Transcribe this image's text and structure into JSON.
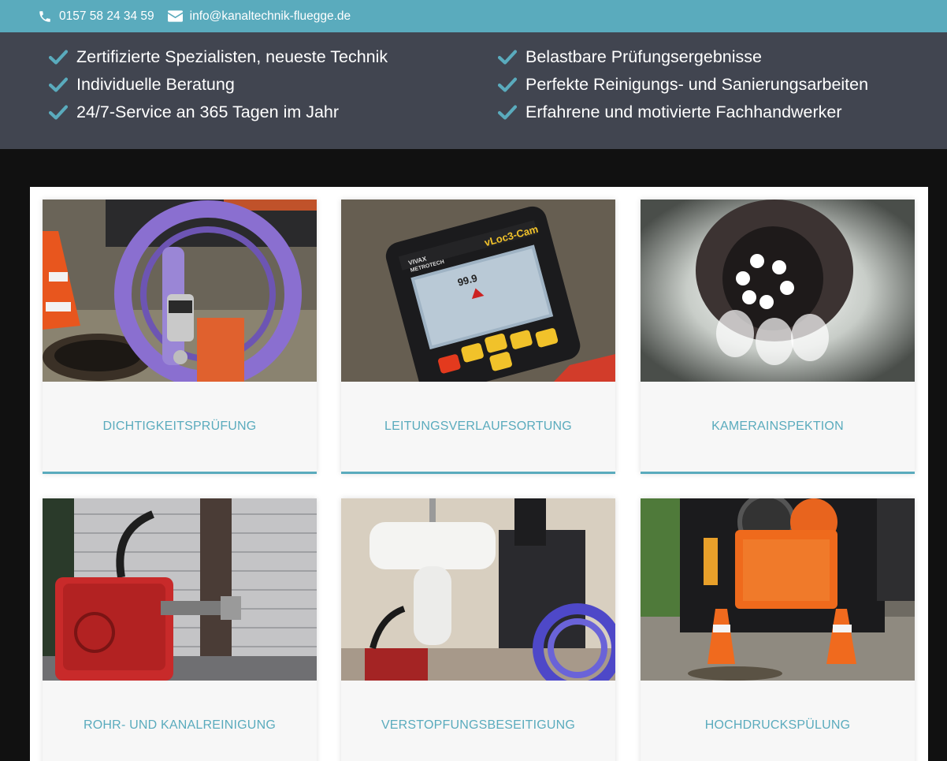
{
  "topbar": {
    "phone": "0157 58 24 34 59",
    "email": "info@kanaltechnik-fluegge.de",
    "phone_icon": "phone-icon",
    "email_icon": "envelope-icon"
  },
  "benefits": {
    "left": [
      "Zertifizierte Spezialisten, neueste Technik",
      "Individuelle Beratung",
      "24/7-Service an 365 Tagen im Jahr"
    ],
    "right": [
      "Belastbare Prüfungsergebnisse",
      "Perfekte Reinigungs- und Sanierungsarbeiten",
      "Erfahrene und motivierte Fachhandwerker"
    ],
    "icon": "check-icon"
  },
  "services": [
    {
      "title": "DICHTIGKEITSPRÜFUNG"
    },
    {
      "title": "LEITUNGSVERLAUFSORTUNG"
    },
    {
      "title": "KAMERAINSPEKTION"
    },
    {
      "title": "ROHR- UND KANALREINIGUNG"
    },
    {
      "title": "VERSTOPFUNGSBESEITIGUNG"
    },
    {
      "title": "HOCHDRUCKSPÜLUNG"
    }
  ],
  "device": {
    "brand_top": "VIVAX",
    "brand_bottom": "METROTECH",
    "model": "vLoc3-Cam",
    "reading": "99.9"
  },
  "colors": {
    "accent": "#5aabbd",
    "benefit_bar": "#414550",
    "page_background": "#111111",
    "card_background": "#f7f7f7"
  }
}
